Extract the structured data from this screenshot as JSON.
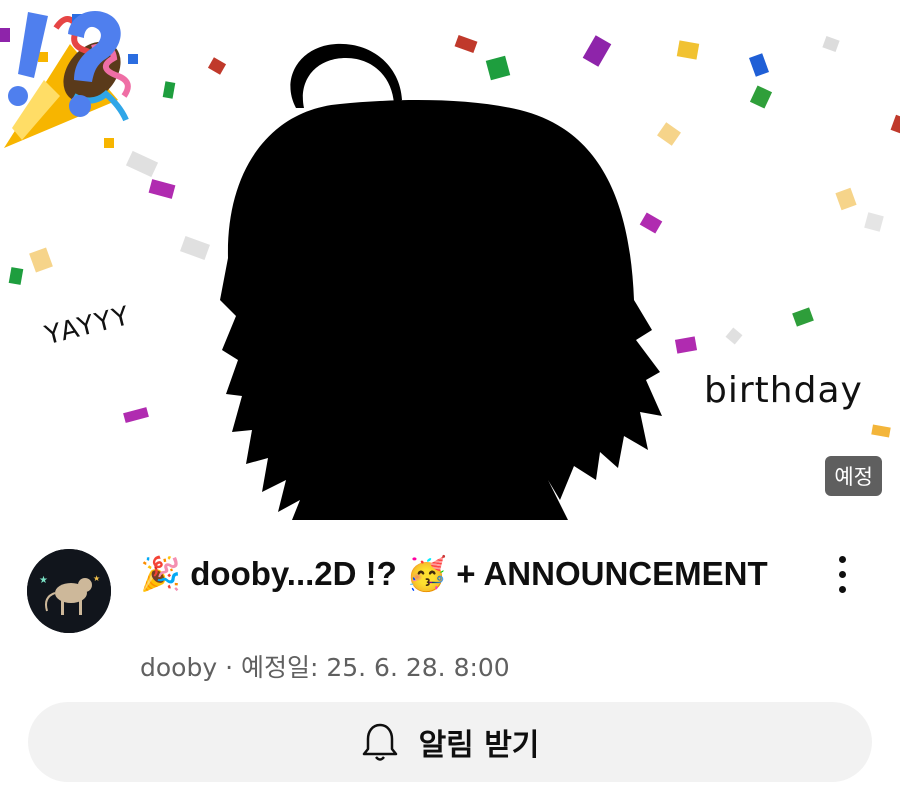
{
  "thumbnail": {
    "doodle_left": "YAYYY",
    "doodle_right": "birthday",
    "marks": "!?",
    "badge": "예정"
  },
  "video": {
    "title_emoji_start": "🎉",
    "title_text": "dooby...2D !?",
    "title_emoji_mid": "🥳",
    "title_text_end": "+ ANNOUNCEMENT",
    "channel": "dooby",
    "separator": "·",
    "scheduled_label": "예정일: 25. 6. 28. 8:00"
  },
  "actions": {
    "notify_label": "알림 받기",
    "more_icon": "more-vert-icon",
    "bell_icon": "bell-icon"
  },
  "colors": {
    "accent_blue": "#4f7fee",
    "badge_bg": "#5f5f5f",
    "button_bg": "#f2f2f2"
  }
}
